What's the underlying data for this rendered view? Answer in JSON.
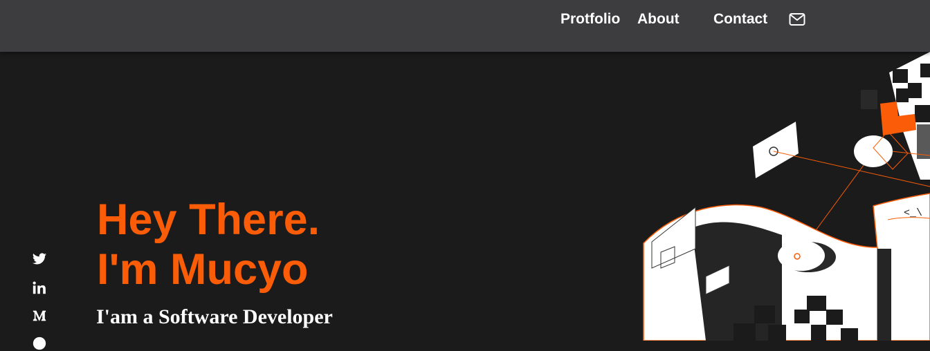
{
  "nav": {
    "links": [
      {
        "label": "Protfolio"
      },
      {
        "label": "About"
      },
      {
        "label": "Contact"
      }
    ],
    "mail_icon": "envelope-icon"
  },
  "social_icons": [
    "twitter-icon",
    "linkedin-icon",
    "medium-icon",
    "github-icon"
  ],
  "hero": {
    "line1": "Hey There.",
    "line2": "I'm Mucyo",
    "subtitle": "I'am a Software Developer"
  },
  "illustration": {
    "code_text": "<_\\"
  },
  "colors": {
    "accent": "#fa5c07",
    "navbar_bg": "#3d3c3e",
    "page_bg": "#1c1b1b",
    "text": "#ffffff"
  }
}
